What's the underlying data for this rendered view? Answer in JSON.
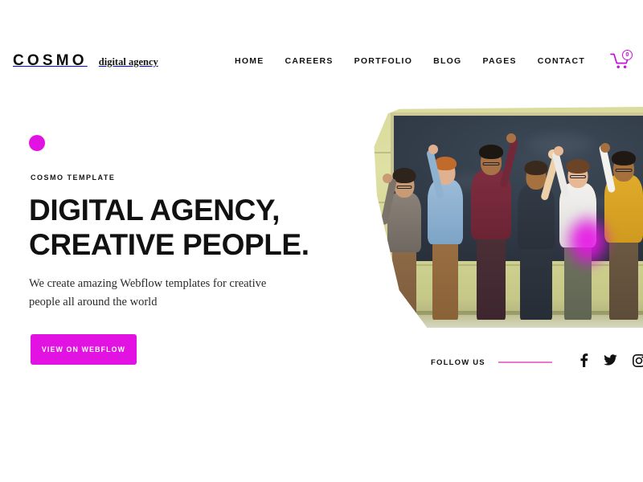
{
  "theme": {
    "accent": "#e212e2",
    "accent_soft": "#e87acb",
    "cart_accent": "#c512d8",
    "text": "#111111",
    "background": "#ffffff"
  },
  "header": {
    "brand_name": "COSMO",
    "brand_tagline": "digital agency",
    "nav": [
      {
        "label": "HOME",
        "name": "nav-home"
      },
      {
        "label": "CAREERS",
        "name": "nav-careers"
      },
      {
        "label": "PORTFOLIO",
        "name": "nav-portfolio"
      },
      {
        "label": "BLOG",
        "name": "nav-blog"
      },
      {
        "label": "PAGES",
        "name": "nav-pages"
      },
      {
        "label": "CONTACT",
        "name": "nav-contact"
      }
    ],
    "cart": {
      "icon": "shopping-cart-icon",
      "count": "0"
    }
  },
  "hero": {
    "eyebrow": "COSMO TEMPLATE",
    "headline_line1": "DIGITAL AGENCY,",
    "headline_line2": "CREATIVE PEOPLE.",
    "subtitle": "We create amazing Webflow templates for creative people all around the world",
    "cta_label": "VIEW ON WEBFLOW",
    "decor_dot": "magenta-dot",
    "photo_alt": "Group of six people cheering with raised fists in front of a chalkboard"
  },
  "follow": {
    "label": "FOLLOW US",
    "socials": [
      {
        "name": "facebook-icon",
        "label": "Facebook"
      },
      {
        "name": "twitter-icon",
        "label": "Twitter"
      },
      {
        "name": "instagram-icon",
        "label": "Instagram"
      }
    ]
  }
}
